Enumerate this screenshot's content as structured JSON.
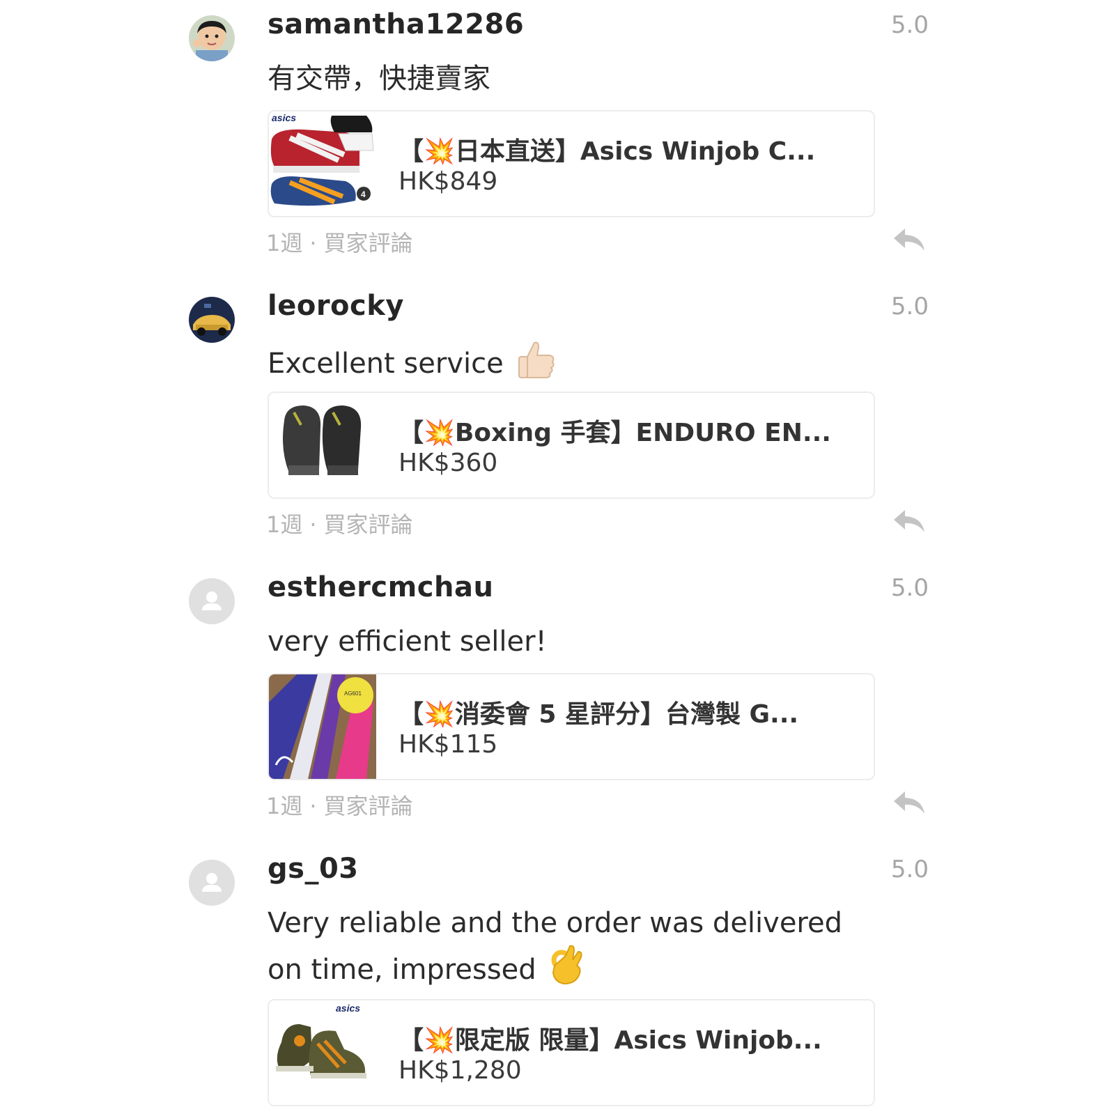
{
  "reviews": [
    {
      "username": "samantha12286",
      "rating": "5.0",
      "comment": "有交帶，快捷賣家",
      "product": {
        "title": "【💥日本直送】Asics Winjob C...",
        "price": "HK$849"
      },
      "time": "1週",
      "type": "買家評論",
      "avatar": "photo-child"
    },
    {
      "username": "leorocky",
      "rating": "5.0",
      "comment": "Excellent service",
      "comment_emoji": "thumbs-up-icon",
      "product": {
        "title": "【💥Boxing 手套】ENDURO EN...",
        "price": "HK$360"
      },
      "time": "1週",
      "type": "買家評論",
      "avatar": "photo-car"
    },
    {
      "username": "esthercmchau",
      "rating": "5.0",
      "comment": "very efficient seller!",
      "product": {
        "title": "【💥消委會 5 星評分】台灣製 G...",
        "price": "HK$115"
      },
      "time": "1週",
      "type": "買家評論",
      "avatar": "default-user-icon"
    },
    {
      "username": "gs_03",
      "rating": "5.0",
      "comment": "Very reliable and the order was delivered on time, impressed",
      "comment_emoji": "ok-hand-icon",
      "product": {
        "title": "【💥限定版 限量】Asics Winjob...",
        "price": "HK$1,280"
      },
      "avatar": "default-user-icon"
    }
  ],
  "colors": {
    "text_primary": "#262626",
    "text_muted": "#b4b4b4",
    "rating": "#a5a5a5",
    "card_border": "#ececec"
  }
}
